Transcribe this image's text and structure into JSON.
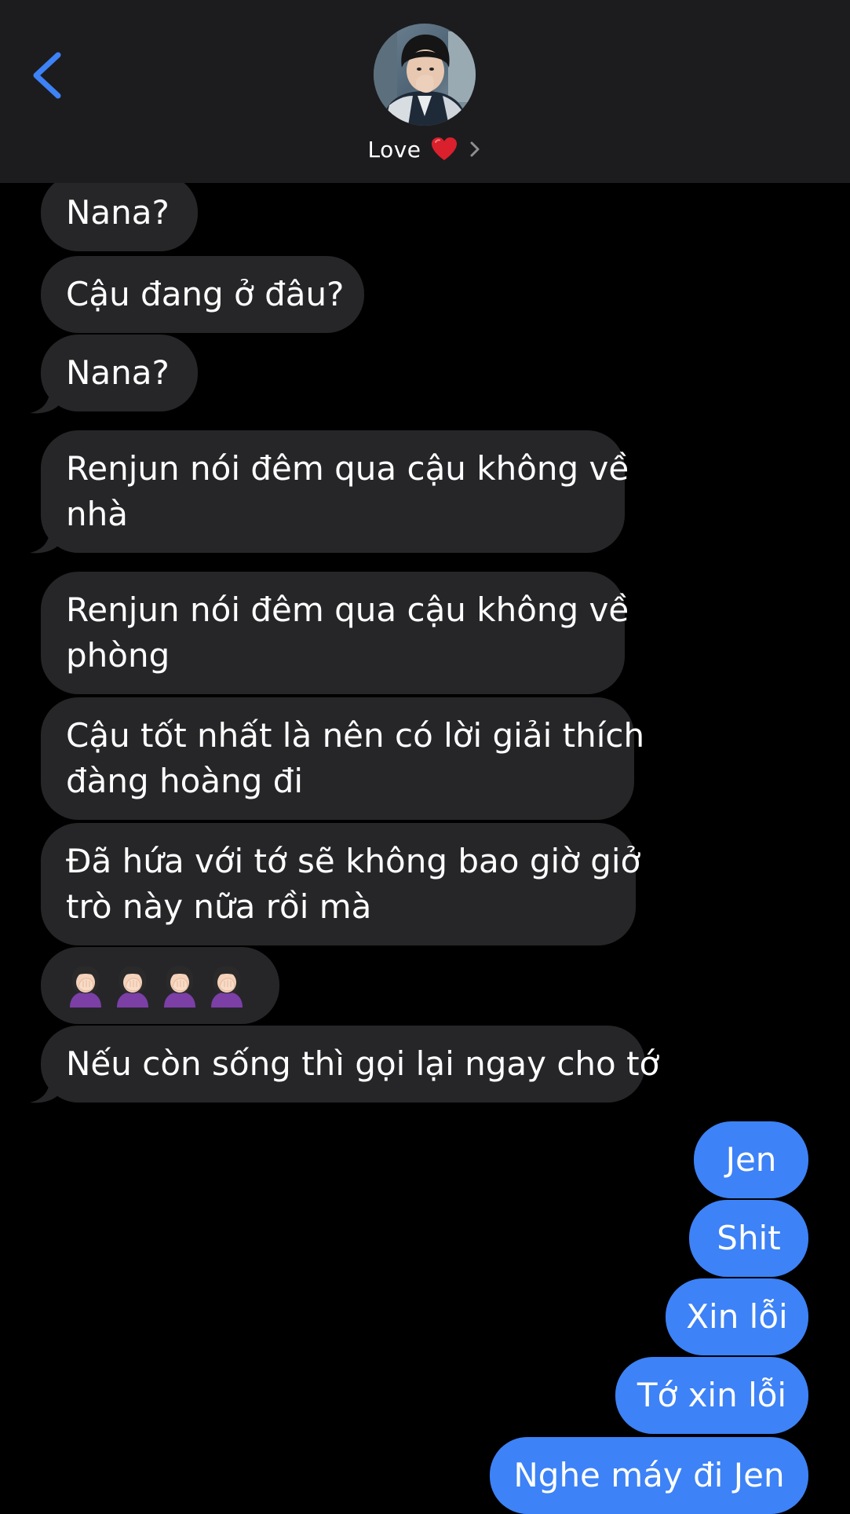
{
  "header": {
    "contact_name": "Love",
    "heart_icon": "red-heart-icon",
    "chevron_icon": "chevron-right-icon",
    "back_icon": "chevron-left-icon",
    "accent_color": "#3d82f6"
  },
  "messages": {
    "incoming": [
      {
        "text": "Nana?"
      },
      {
        "text": "Cậu đang ở đâu?"
      },
      {
        "text": "Nana?"
      },
      {
        "line1": "Renjun nói đêm qua cậu không về",
        "line2": "nhà"
      },
      {
        "line1": "Renjun nói đêm qua cậu không về",
        "line2": "phòng"
      },
      {
        "line1": "Cậu tốt nhất là nên có lời giải thích",
        "line2": "đàng hoàng đi"
      },
      {
        "line1": "Đã hứa với tớ sẽ không bao giờ giở",
        "line2": "trò này nữa rồi mà"
      },
      {
        "emoji": "🤦🏻‍♀️🤦🏻‍♀️🤦🏻‍♀️🤦🏻‍♀️"
      },
      {
        "text": "Nếu còn sống thì gọi lại ngay cho tớ"
      }
    ],
    "outgoing": [
      {
        "text": "Jen"
      },
      {
        "text": "Shit"
      },
      {
        "text": "Xin lỗi"
      },
      {
        "text": "Tớ xin lỗi"
      },
      {
        "text": "Nghe máy đi Jen"
      }
    ]
  },
  "colors": {
    "incoming_bubble": "#262629",
    "outgoing_bubble": "#3d82f6",
    "header_bg": "#1c1c1e"
  }
}
